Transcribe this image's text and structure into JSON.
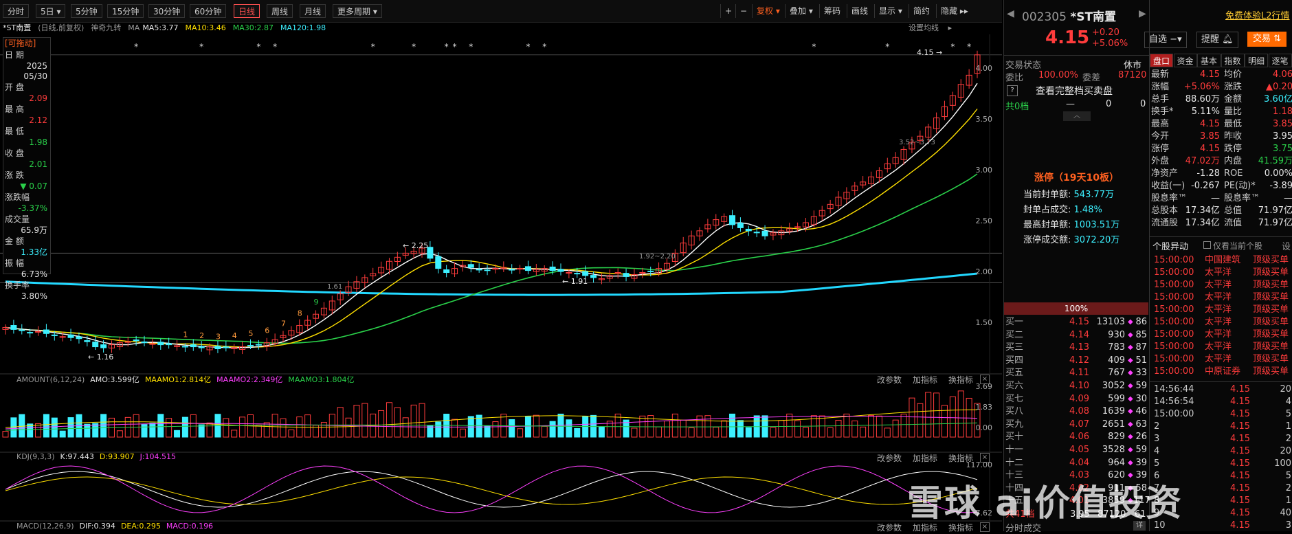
{
  "toolbar": {
    "periods": [
      "分时",
      "5日",
      "5分钟",
      "15分钟",
      "30分钟",
      "60分钟",
      "日线",
      "周线",
      "月线",
      "更多周期"
    ],
    "active_period": "日线",
    "right": [
      "+",
      "−",
      "复权",
      "叠加",
      "筹码",
      "画线",
      "显示",
      "简约",
      "隐藏"
    ]
  },
  "ma_line": {
    "stock": "*ST南置",
    "mode": "(日线,前复权)",
    "indicator": "神奇九转",
    "ma": "MA",
    "ma5": "MA5:3.77",
    "ma10": "MA10:3.46",
    "ma30": "MA30:2.87",
    "ma120": "MA120:1.98",
    "set_ma": "设置均线"
  },
  "left_panel": {
    "drag": "[可拖动]",
    "date_label": "日  期",
    "date_year": "2025",
    "date_md": "05/30",
    "open_label": "开  盘",
    "open": "2.09",
    "high_label": "最  高",
    "high": "2.12",
    "low_label": "最  低",
    "low": "1.98",
    "close_label": "收  盘",
    "close": "2.01",
    "chg_label": "涨  跌",
    "chg": "▼ 0.07",
    "pct_label": "涨跌幅",
    "pct": "-3.37%",
    "vol_label": "成交量",
    "vol": "65.9万",
    "amt_label": "金  额",
    "amt": "1.33亿",
    "amp_label": "振  幅",
    "amp": "6.73%",
    "turn_label": "换手率",
    "turn": "3.80%"
  },
  "price_axis": [
    "4.00",
    "3.50",
    "3.00",
    "2.50",
    "2.00",
    "1.50"
  ],
  "annotations": {
    "high": "4.15",
    "low": "1.16",
    "p225": "2.25",
    "p191": "1.91",
    "p161": "1.61",
    "p192": "1.92~2.20",
    "p352": "3.52~3.73"
  },
  "amount": {
    "name": "AMOUNT(6,12,24)",
    "amo": "AMO:3.599亿",
    "m1": "MAAMO1:2.814亿",
    "m2": "MAAMO2:2.349亿",
    "m3": "MAAMO3:1.804亿",
    "axis": [
      "3.69",
      "1.83",
      "0.00"
    ],
    "btns": [
      "改参数",
      "加指标",
      "换指标"
    ]
  },
  "kdj": {
    "name": "KDJ(9,3,3)",
    "k": "K:97.443",
    "d": "D:93.907",
    "j": "J:104.515",
    "axis": [
      "117.00",
      "-7.62"
    ],
    "btns": [
      "改参数",
      "加指标",
      "换指标"
    ]
  },
  "macd": {
    "name": "MACD(12,26,9)",
    "dif": "DIF:0.394",
    "dea": "DEA:0.295",
    "macd": "MACD:0.196",
    "btns": [
      "改参数",
      "加指标",
      "换指标"
    ]
  },
  "right": {
    "code": "002305",
    "name": "*ST南置",
    "trial": "免费体验L2行情",
    "price": "4.15",
    "chg": "+0.20",
    "pct": "+5.06%",
    "watch": "自选",
    "alert": "提醒",
    "trade": "交易",
    "status_label": "交易状态",
    "status": "休市",
    "wb_label": "委比",
    "wb": "100.00%",
    "wc_label": "委差",
    "wc": "87120",
    "full_book": "查看完整档买卖盘",
    "sell_total_label": "共0档",
    "sell_total_dash": "—",
    "sell_total_a": "0",
    "sell_total_b": "0",
    "limit_title": "涨停（19天10板）",
    "limit_rows": [
      {
        "label": "当前封单额:",
        "value": "543.77万"
      },
      {
        "label": "封单占成交:",
        "value": "1.48%"
      },
      {
        "label": "最高封单额:",
        "value": "1003.51万"
      },
      {
        "label": "涨停成交额:",
        "value": "3072.20万"
      }
    ],
    "pct_bar": "100%",
    "book": [
      {
        "lab": "买一",
        "p": "4.15",
        "v": "13103",
        "n": "86"
      },
      {
        "lab": "买二",
        "p": "4.14",
        "v": "930",
        "n": "85"
      },
      {
        "lab": "买三",
        "p": "4.13",
        "v": "783",
        "n": "87"
      },
      {
        "lab": "买四",
        "p": "4.12",
        "v": "409",
        "n": "51"
      },
      {
        "lab": "买五",
        "p": "4.11",
        "v": "767",
        "n": "33"
      },
      {
        "lab": "买六",
        "p": "4.10",
        "v": "3052",
        "n": "59"
      },
      {
        "lab": "买七",
        "p": "4.09",
        "v": "599",
        "n": "30"
      },
      {
        "lab": "买八",
        "p": "4.08",
        "v": "1639",
        "n": "46"
      },
      {
        "lab": "买九",
        "p": "4.07",
        "v": "2651",
        "n": "63"
      },
      {
        "lab": "买十",
        "p": "4.06",
        "v": "829",
        "n": "26"
      },
      {
        "lab": "十一",
        "p": "4.05",
        "v": "3528",
        "n": "59"
      },
      {
        "lab": "十二",
        "p": "4.04",
        "v": "964",
        "n": "39"
      },
      {
        "lab": "十三",
        "p": "4.03",
        "v": "620",
        "n": "39"
      },
      {
        "lab": "十四",
        "p": "4.02",
        "v": "911",
        "n": "58"
      },
      {
        "lab": "十五",
        "p": "4.01",
        "v": "3859",
        "n": "117"
      }
    ],
    "buy_total_label": "共41档",
    "buy_total_p": "3.95",
    "buy_total_v": "87120",
    "buy_total_n": "61",
    "ticks_label": "分时成交",
    "tabs": [
      "盘口",
      "资金",
      "基本",
      "指数",
      "明细",
      "逐笔"
    ],
    "quote": [
      {
        "l1": "最新",
        "v1": "4.15",
        "c1": "red",
        "l2": "均价",
        "v2": "4.06",
        "c2": "red"
      },
      {
        "l1": "涨幅",
        "v1": "+5.06%",
        "c1": "red",
        "l2": "涨跌",
        "v2": "▲0.20",
        "c2": "red"
      },
      {
        "l1": "总手",
        "v1": "88.60万",
        "c1": "wht",
        "l2": "金额",
        "v2": "3.60亿",
        "c2": "cyan"
      },
      {
        "l1": "换手*",
        "v1": "5.11%",
        "c1": "wht",
        "l2": "量比",
        "v2": "1.18",
        "c2": "red"
      },
      {
        "l1": "最高",
        "v1": "4.15",
        "c1": "red",
        "l2": "最低",
        "v2": "3.85",
        "c2": "red"
      },
      {
        "l1": "今开",
        "v1": "3.85",
        "c1": "red",
        "l2": "昨收",
        "v2": "3.95",
        "c2": "wht"
      },
      {
        "l1": "涨停",
        "v1": "4.15",
        "c1": "red",
        "l2": "跌停",
        "v2": "3.75",
        "c2": "grn"
      },
      {
        "l1": "外盘",
        "v1": "47.02万",
        "c1": "red",
        "l2": "内盘",
        "v2": "41.59万",
        "c2": "grn"
      },
      {
        "l1": "净资产",
        "v1": "-1.28",
        "c1": "wht",
        "l2": "ROE",
        "v2": "0.00%",
        "c2": "wht"
      },
      {
        "l1": "收益(一)",
        "v1": "-0.267",
        "c1": "wht",
        "l2": "PE(动)*",
        "v2": "-3.89",
        "c2": "wht"
      },
      {
        "l1": "股息率™",
        "v1": "—",
        "c1": "wht",
        "l2": "股息率™",
        "v2": "—",
        "c2": "wht"
      },
      {
        "l1": "总股本",
        "v1": "17.34亿",
        "c1": "wht",
        "l2": "总值",
        "v2": "71.97亿",
        "c2": "wht"
      },
      {
        "l1": "流通股",
        "v1": "17.34亿",
        "c1": "wht",
        "l2": "流值",
        "v2": "71.97亿",
        "c2": "wht"
      }
    ],
    "ls_title": "个股异动",
    "ls_only": "仅看当前个股",
    "ls_more": "设",
    "ls": [
      {
        "t": "15:00:00",
        "nm": "中国建筑",
        "ty": "顶级买单"
      },
      {
        "t": "15:00:00",
        "nm": "太平洋",
        "ty": "顶级买单"
      },
      {
        "t": "15:00:00",
        "nm": "太平洋",
        "ty": "顶级买单"
      },
      {
        "t": "15:00:00",
        "nm": "太平洋",
        "ty": "顶级买单"
      },
      {
        "t": "15:00:00",
        "nm": "太平洋",
        "ty": "顶级买单"
      },
      {
        "t": "15:00:00",
        "nm": "太平洋",
        "ty": "顶级买单"
      },
      {
        "t": "15:00:00",
        "nm": "太平洋",
        "ty": "顶级买单"
      },
      {
        "t": "15:00:00",
        "nm": "太平洋",
        "ty": "顶级买单"
      },
      {
        "t": "15:00:00",
        "nm": "太平洋",
        "ty": "顶级买单"
      },
      {
        "t": "15:00:00",
        "nm": "中原证券",
        "ty": "顶级买单"
      }
    ],
    "trades": [
      {
        "t": "14:56:44",
        "p": "4.15",
        "v": "20"
      },
      {
        "t": "14:56:54",
        "p": "4.15",
        "v": "4"
      },
      {
        "t": "15:00:00",
        "p": "4.15",
        "v": "5"
      },
      {
        "t": "2",
        "p": "4.15",
        "v": "1"
      },
      {
        "t": "3",
        "p": "4.15",
        "v": "2"
      },
      {
        "t": "4",
        "p": "4.15",
        "v": "20"
      },
      {
        "t": "5",
        "p": "4.15",
        "v": "100"
      },
      {
        "t": "6",
        "p": "4.15",
        "v": "5"
      },
      {
        "t": "7",
        "p": "4.15",
        "v": "2"
      },
      {
        "t": "8",
        "p": "4.15",
        "v": "1"
      },
      {
        "t": "9",
        "p": "4.15",
        "v": "40"
      },
      {
        "t": "10",
        "p": "4.15",
        "v": "3"
      }
    ]
  },
  "watermark": "雪球 ai价值投资",
  "colors": {
    "up": "#ff3c3c",
    "down": "#3cf0ff",
    "ma5": "#ffffff",
    "ma10": "#ffe000",
    "ma30": "#2ad14a",
    "ma120": "#22d8ff",
    "accent": "#ff6020"
  },
  "chart_data": {
    "type": "candlestick",
    "closes": [
      1.47,
      1.45,
      1.44,
      1.42,
      1.43,
      1.41,
      1.39,
      1.38,
      1.37,
      1.36,
      1.33,
      1.28,
      1.27,
      1.3,
      1.32,
      1.33,
      1.34,
      1.32,
      1.31,
      1.3,
      1.3,
      1.29,
      1.28,
      1.28,
      1.27,
      1.28,
      1.26,
      1.27,
      1.27,
      1.28,
      1.29,
      1.3,
      1.32,
      1.35,
      1.39,
      1.44,
      1.49,
      1.54,
      1.6,
      1.66,
      1.73,
      1.8,
      1.87,
      1.92,
      1.96,
      2.0,
      2.06,
      2.12,
      2.16,
      2.2,
      2.22,
      2.25,
      2.15,
      2.05,
      2.01,
      2.05,
      2.08,
      2.06,
      2.04,
      2.03,
      2.05,
      2.06,
      2.04,
      2.05,
      2.03,
      2.04,
      2.05,
      2.03,
      2.02,
      2.01,
      2.0,
      1.98,
      1.96,
      1.95,
      1.98,
      2.01,
      1.97,
      1.99,
      2.01,
      2.02,
      2.05,
      2.1,
      2.2,
      2.3,
      2.37,
      2.42,
      2.48,
      2.53,
      2.56,
      2.48,
      2.45,
      2.42,
      2.4,
      2.37,
      2.4,
      2.42,
      2.44,
      2.46,
      2.5,
      2.56,
      2.62,
      2.68,
      2.75,
      2.8,
      2.86,
      2.9,
      2.95,
      3.01,
      3.08,
      3.14,
      3.22,
      3.29,
      3.35,
      3.44,
      3.53,
      3.64,
      3.75,
      3.86,
      3.95,
      4.15
    ]
  }
}
